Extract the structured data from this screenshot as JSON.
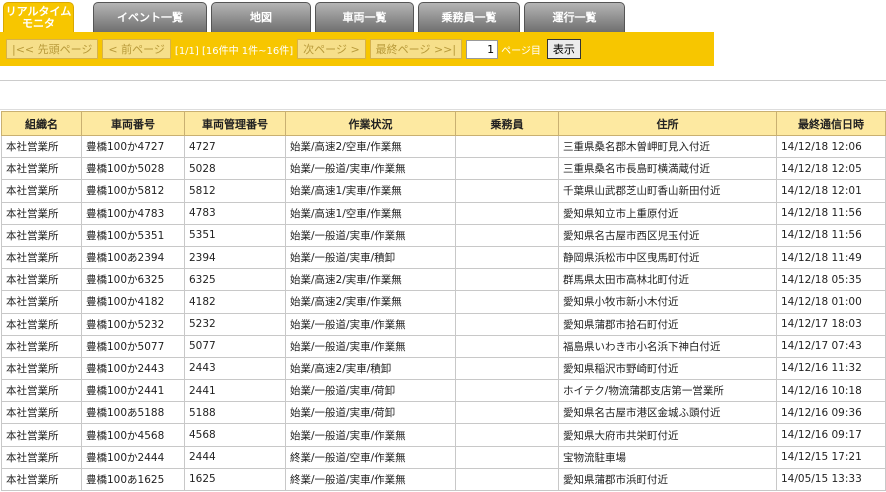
{
  "tabs": [
    {
      "label": "リアルタイム\nモニタ",
      "active": true
    },
    {
      "label": "イベント一覧",
      "active": false
    },
    {
      "label": "地図",
      "active": false
    },
    {
      "label": "車両一覧",
      "active": false
    },
    {
      "label": "乗務員一覧",
      "active": false
    },
    {
      "label": "運行一覧",
      "active": false
    }
  ],
  "pager": {
    "first_label": "|<< 先頭ページ",
    "prev_label": "< 前ページ",
    "info": "[1/1] [16件中 1件~16件]",
    "next_label": "次ページ >",
    "last_label": "最終ページ >>|",
    "page_value": "1",
    "page_suffix": "ページ目",
    "show_label": "表示"
  },
  "table": {
    "headers": [
      "組織名",
      "車両番号",
      "車両管理番号",
      "作業状況",
      "乗務員",
      "住所",
      "最終通信日時"
    ],
    "rows": [
      [
        "本社営業所",
        "豊橋100か4727",
        "4727",
        "始業/高速2/空車/作業無",
        "",
        "三重県桑名郡木曽岬町見入付近",
        "14/12/18 12:06"
      ],
      [
        "本社営業所",
        "豊橋100か5028",
        "5028",
        "始業/一般道/実車/作業無",
        "",
        "三重県桑名市長島町横満蔵付近",
        "14/12/18 12:05"
      ],
      [
        "本社営業所",
        "豊橋100か5812",
        "5812",
        "始業/高速1/実車/作業無",
        "",
        "千葉県山武郡芝山町香山新田付近",
        "14/12/18 12:01"
      ],
      [
        "本社営業所",
        "豊橋100か4783",
        "4783",
        "始業/高速1/空車/作業無",
        "",
        "愛知県知立市上重原付近",
        "14/12/18 11:56"
      ],
      [
        "本社営業所",
        "豊橋100か5351",
        "5351",
        "始業/一般道/実車/作業無",
        "",
        "愛知県名古屋市西区児玉付近",
        "14/12/18 11:56"
      ],
      [
        "本社営業所",
        "豊橋100あ2394",
        "2394",
        "始業/一般道/実車/積卸",
        "",
        "静岡県浜松市中区曳馬町付近",
        "14/12/18 11:49"
      ],
      [
        "本社営業所",
        "豊橋100か6325",
        "6325",
        "始業/高速2/実車/作業無",
        "",
        "群馬県太田市高林北町付近",
        "14/12/18 05:35"
      ],
      [
        "本社営業所",
        "豊橋100か4182",
        "4182",
        "始業/高速2/実車/作業無",
        "",
        "愛知県小牧市新小木付近",
        "14/12/18 01:00"
      ],
      [
        "本社営業所",
        "豊橋100か5232",
        "5232",
        "始業/一般道/実車/作業無",
        "",
        "愛知県蒲郡市拾石町付近",
        "14/12/17 18:03"
      ],
      [
        "本社営業所",
        "豊橋100か5077",
        "5077",
        "始業/一般道/実車/作業無",
        "",
        "福島県いわき市小名浜下神白付近",
        "14/12/17 07:43"
      ],
      [
        "本社営業所",
        "豊橋100か2443",
        "2443",
        "始業/高速2/実車/積卸",
        "",
        "愛知県稲沢市野崎町付近",
        "14/12/16 11:32"
      ],
      [
        "本社営業所",
        "豊橋100か2441",
        "2441",
        "始業/一般道/実車/荷卸",
        "",
        "ホイテク/物流蒲郡支店第一営業所",
        "14/12/16 10:18"
      ],
      [
        "本社営業所",
        "豊橋100あ5188",
        "5188",
        "始業/一般道/実車/荷卸",
        "",
        "愛知県名古屋市港区金城ふ頭付近",
        "14/12/16 09:36"
      ],
      [
        "本社営業所",
        "豊橋100か4568",
        "4568",
        "始業/一般道/実車/作業無",
        "",
        "愛知県大府市共栄町付近",
        "14/12/16 09:17"
      ],
      [
        "本社営業所",
        "豊橋100か2444",
        "2444",
        "終業/一般道/空車/作業無",
        "",
        "宝物流駐車場",
        "14/12/15 17:21"
      ],
      [
        "本社営業所",
        "豊橋100あ1625",
        "1625",
        "終業/一般道/実車/作業無",
        "",
        "愛知県蒲郡市浜町付近",
        "14/05/15 13:33"
      ]
    ]
  }
}
